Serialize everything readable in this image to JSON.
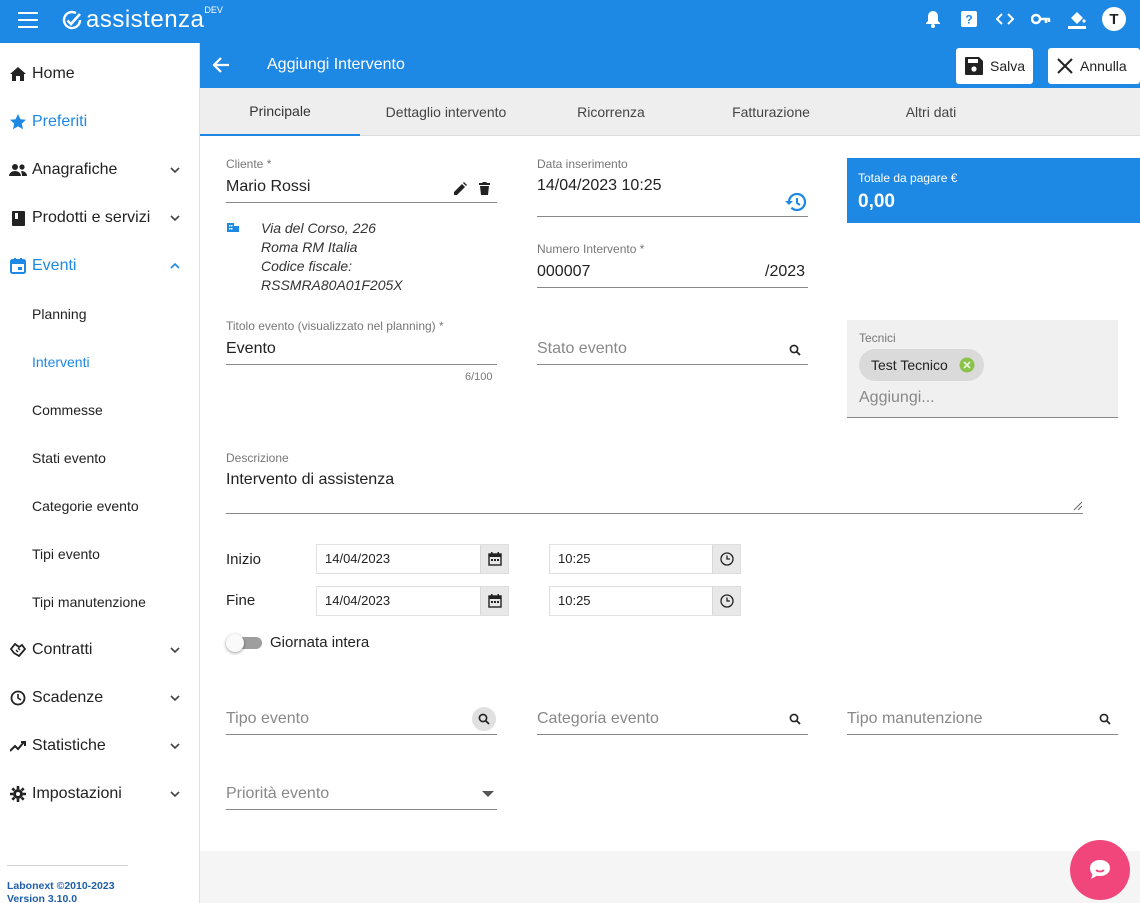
{
  "app": {
    "name": "assistenza",
    "env": "DEV",
    "user_initial": "T"
  },
  "appbar_icons": [
    "bell-icon",
    "help-icon",
    "code-icon",
    "key-icon",
    "paint-bucket-icon"
  ],
  "sidebar": {
    "items": [
      {
        "label": "Home",
        "icon": "home-icon"
      },
      {
        "label": "Preferiti",
        "icon": "star-icon"
      },
      {
        "label": "Anagrafiche",
        "icon": "people-icon"
      },
      {
        "label": "Prodotti e servizi",
        "icon": "book-icon"
      },
      {
        "label": "Eventi",
        "icon": "calendar-icon"
      },
      {
        "label": "Planning"
      },
      {
        "label": "Interventi"
      },
      {
        "label": "Commesse"
      },
      {
        "label": "Stati evento"
      },
      {
        "label": "Categorie evento"
      },
      {
        "label": "Tipi evento"
      },
      {
        "label": "Tipi manutenzione"
      },
      {
        "label": "Contratti",
        "icon": "handshake-icon"
      },
      {
        "label": "Scadenze",
        "icon": "clock-icon"
      },
      {
        "label": "Statistiche",
        "icon": "trending-icon"
      },
      {
        "label": "Impostazioni",
        "icon": "gear-icon"
      }
    ],
    "footer_line1": "Labonext ©2010-2023",
    "footer_line2": "Version 3.10.0"
  },
  "header": {
    "title": "Aggiungi Intervento",
    "save_label": "Salva",
    "cancel_label": "Annulla"
  },
  "tabs": [
    {
      "label": "Principale"
    },
    {
      "label": "Dettaglio intervento"
    },
    {
      "label": "Ricorrenza"
    },
    {
      "label": "Fatturazione"
    },
    {
      "label": "Altri dati"
    }
  ],
  "form": {
    "cliente": {
      "label": "Cliente *",
      "value": "Mario Rossi"
    },
    "indirizzo": {
      "line1": "Via del Corso, 226",
      "line2": "Roma RM Italia",
      "line3": "Codice fiscale:",
      "line4": "RSSMRA80A01F205X"
    },
    "data_inserimento": {
      "label": "Data inserimento",
      "value": "14/04/2023 10:25"
    },
    "numero_intervento": {
      "label": "Numero Intervento *",
      "value": "000007",
      "suffix": "/2023"
    },
    "totale": {
      "label": "Totale da pagare €",
      "value": "0,00"
    },
    "titolo": {
      "label": "Titolo evento (visualizzato nel planning) *",
      "value": "Evento",
      "counter": "6/100"
    },
    "stato_evento": {
      "placeholder": "Stato evento"
    },
    "tecnici": {
      "label": "Tecnici",
      "chip": "Test Tecnico",
      "placeholder": "Aggiungi..."
    },
    "descrizione": {
      "label": "Descrizione",
      "value": "Intervento di assistenza"
    },
    "inizio": {
      "label": "Inizio",
      "date": "14/04/2023",
      "time": "10:25"
    },
    "fine": {
      "label": "Fine",
      "date": "14/04/2023",
      "time": "10:25"
    },
    "giornata_intera": {
      "label": "Giornata intera",
      "checked": false
    },
    "tipo_evento": {
      "placeholder": "Tipo evento"
    },
    "categoria_evento": {
      "placeholder": "Categoria evento"
    },
    "tipo_manutenzione": {
      "placeholder": "Tipo manutenzione"
    },
    "priorita_evento": {
      "placeholder": "Priorità evento"
    }
  },
  "colors": {
    "primary": "#1e88e5",
    "chat": "#f0467c",
    "chip_remove": "#8bc34a"
  }
}
